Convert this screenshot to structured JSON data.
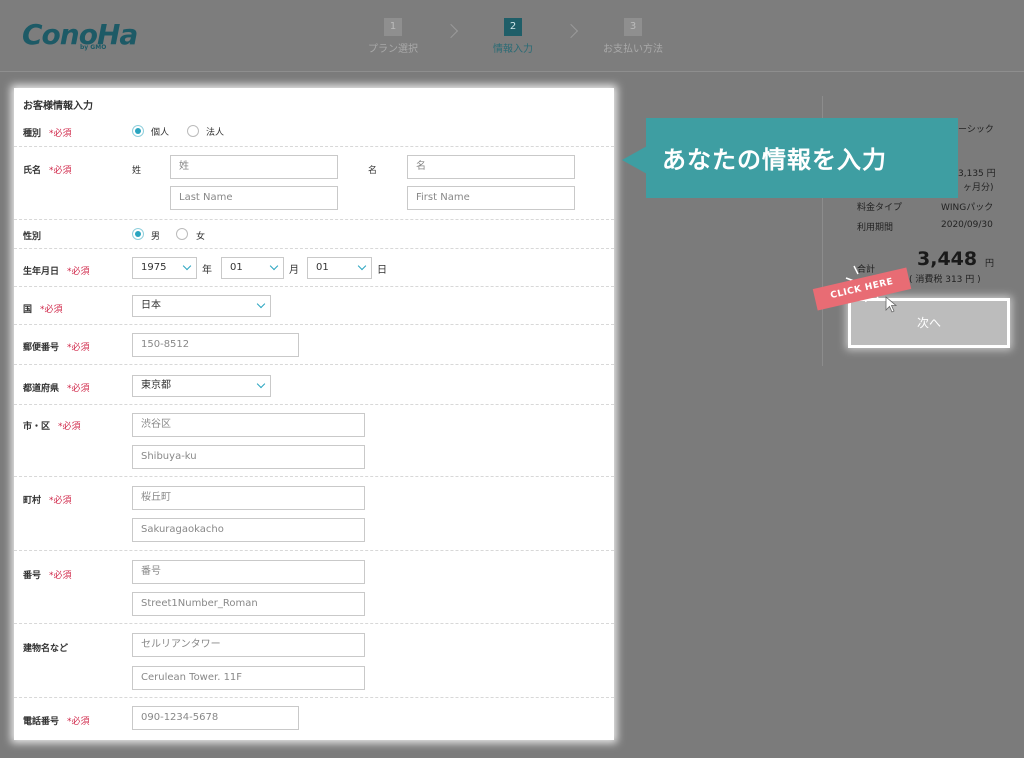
{
  "logo": {
    "main": "ConoHa",
    "sub": "by GMO"
  },
  "steps": [
    {
      "num": "1",
      "label": "プラン選択"
    },
    {
      "num": "2",
      "label": "情報入力"
    },
    {
      "num": "3",
      "label": "お支払い方法"
    }
  ],
  "form": {
    "title": "お客様情報入力",
    "required": "*必須",
    "type": {
      "label": "種別",
      "options": [
        "個人",
        "法人"
      ],
      "selected": "個人"
    },
    "name": {
      "label": "氏名",
      "sei": "姓",
      "mei": "名",
      "sei_placeholder": "姓",
      "mei_placeholder": "名",
      "last_placeholder": "Last Name",
      "first_placeholder": "First Name"
    },
    "gender": {
      "label": "性別",
      "options": [
        "男",
        "女"
      ],
      "selected": "男"
    },
    "birthday": {
      "label": "生年月日",
      "year": "1975",
      "year_unit": "年",
      "month": "01",
      "month_unit": "月",
      "day": "01",
      "day_unit": "日"
    },
    "country": {
      "label": "国",
      "value": "日本"
    },
    "postal": {
      "label": "郵便番号",
      "placeholder": "150-8512"
    },
    "prefecture": {
      "label": "都道府県",
      "value": "東京都"
    },
    "city": {
      "label": "市・区",
      "placeholder_jp": "渋谷区",
      "placeholder_en": "Shibuya-ku"
    },
    "town": {
      "label": "町村",
      "placeholder_jp": "桜丘町",
      "placeholder_en": "Sakuragaokacho"
    },
    "number": {
      "label": "番号",
      "placeholder_jp": "番号",
      "placeholder_en": "Street1Number_Roman"
    },
    "building": {
      "label": "建物名など",
      "placeholder_jp": "セルリアンタワー",
      "placeholder_en": "Cerulean Tower. 11F"
    },
    "phone": {
      "label": "電話番号",
      "placeholder": "090-1234-5678"
    }
  },
  "sidebar": {
    "plan_partial": "ーシック",
    "price_partial": "3,135 円",
    "months_partial": "ヶ月分)",
    "fee_type_label": "料金タイプ",
    "fee_type_value": "WINGパック",
    "period_label": "利用期間",
    "period_value": "2020/09/30",
    "total_label": "合計",
    "total_value": "3,448",
    "yen": "円",
    "tax": "( 消費税 313 円 )",
    "next_button": "次へ"
  },
  "callout": {
    "text": "あなたの情報を入力"
  },
  "click_here": "CLICK HERE",
  "colors": {
    "accent": "#2aa5c0",
    "callout": "#3e9ea2",
    "required": "#d0284a",
    "click_badge": "#e86c74"
  }
}
